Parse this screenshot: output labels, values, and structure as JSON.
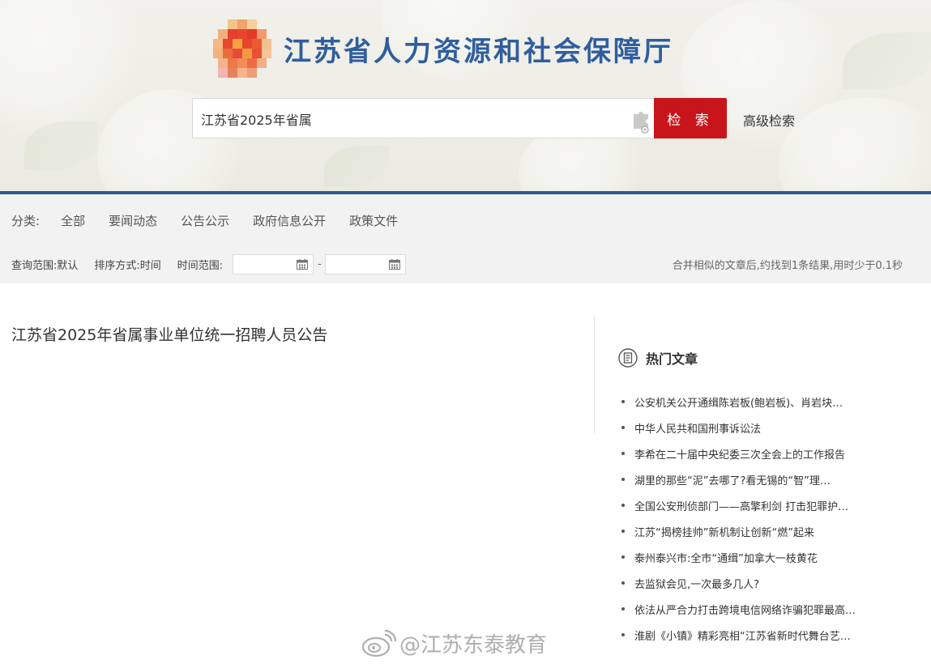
{
  "header": {
    "site_title": "江苏省人力资源和社会保障厅"
  },
  "search": {
    "query": "江苏省2025年省属",
    "button_label": "检 索",
    "advanced_label": "高级检索"
  },
  "categories": {
    "label": "分类:",
    "items": [
      "全部",
      "要闻动态",
      "公告公示",
      "政府信息公开",
      "政策文件"
    ]
  },
  "options": {
    "scope": "查询范围:默认",
    "sort": "排序方式:时间",
    "time_range_label": "时间范围:",
    "date_separator": "-",
    "result_info": "合并相似的文章后,约找到1条结果,用时少于0.1秒"
  },
  "results": [
    {
      "title": "江苏省2025年省属事业单位统一招聘人员公告"
    }
  ],
  "hot": {
    "title": "热门文章",
    "items": [
      "公安机关公开通缉陈岩板(鲍岩板)、肖岩块…",
      "中华人民共和国刑事诉讼法",
      "李希在二十届中央纪委三次全会上的工作报告",
      "湖里的那些“泥”去哪了?看无锡的“智”理…",
      "全国公安刑侦部门——高擎利剑 打击犯罪护…",
      "江苏“揭榜挂帅”新机制让创新“燃”起来",
      "泰州泰兴市:全市“通缉”加拿大一枝黄花",
      "去监狱会见,一次最多几人?",
      "依法从严合力打击跨境电信网络诈骗犯罪最高…",
      "淮剧《小镇》精彩亮相“江苏省新时代舞台艺…"
    ]
  },
  "watermark": "@江苏东泰教育",
  "colors": {
    "brand_blue": "#2f5e9e",
    "accent_red": "#c8141b",
    "filter_bg": "#f2f2f2"
  }
}
